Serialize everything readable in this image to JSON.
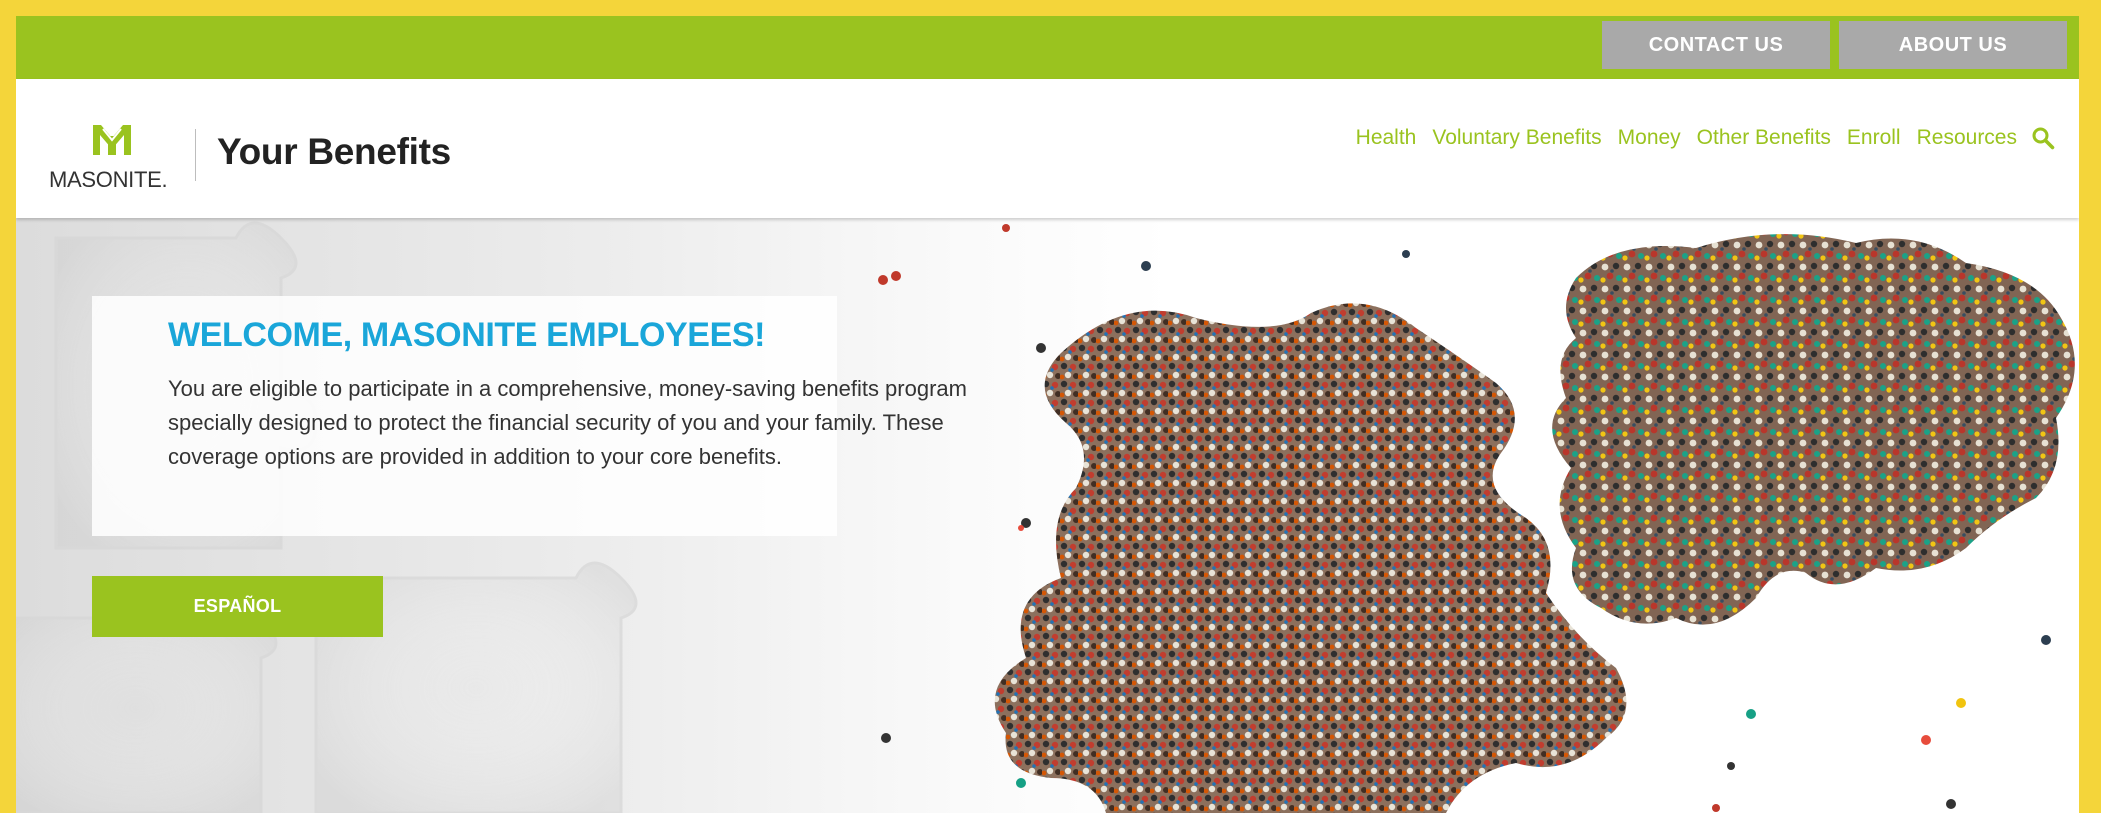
{
  "utility_bar": {
    "contact_label": "CONTACT US",
    "about_label": "ABOUT US"
  },
  "header": {
    "logo_text": "MASONITE.",
    "site_title": "Your Benefits",
    "nav": [
      {
        "label": "Health"
      },
      {
        "label": "Voluntary Benefits"
      },
      {
        "label": "Money"
      },
      {
        "label": "Other Benefits"
      },
      {
        "label": "Enroll"
      },
      {
        "label": "Resources"
      }
    ],
    "search_icon": "search-icon"
  },
  "hero": {
    "title": "WELCOME, MASONITE EMPLOYEES!",
    "body": "You are eligible to participate in a comprehensive, money-saving benefits program specially designed to protect the financial security of you and your family. These coverage options are provided in addition to your core benefits.",
    "espanol_label": "ESPAÑOL",
    "image": "crowd-puzzle-pieces-image"
  },
  "colors": {
    "brand_green": "#9ac31f",
    "title_blue": "#1aa6d9",
    "utility_button_gray": "#a9a9a9",
    "frame_yellow": "#f4d53a"
  }
}
